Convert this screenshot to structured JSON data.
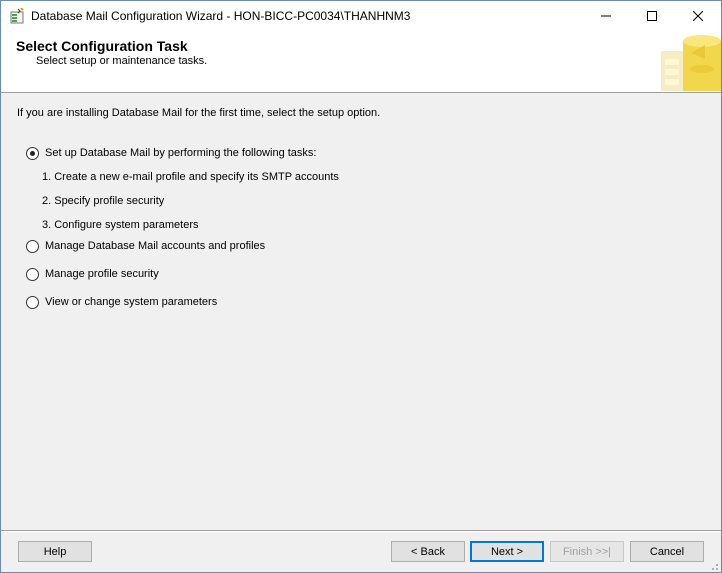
{
  "window": {
    "title": "Database Mail Configuration Wizard - HON-BICC-PC0034\\THANHNM3"
  },
  "header": {
    "title": "Select Configuration Task",
    "subtitle": "Select setup or maintenance tasks."
  },
  "main": {
    "intro": "If you are installing Database Mail for the first time, select the setup option.",
    "options": [
      {
        "label": "Set up Database Mail by performing the following tasks:",
        "selected": true
      },
      {
        "label": "Manage Database Mail accounts and profiles",
        "selected": false
      },
      {
        "label": "Manage profile security",
        "selected": false
      },
      {
        "label": "View or change system parameters",
        "selected": false
      }
    ],
    "setup_steps": [
      "1. Create a new e-mail profile and specify its SMTP accounts",
      "2. Specify profile security",
      "3. Configure system parameters"
    ]
  },
  "footer": {
    "help": "Help",
    "back": "< Back",
    "next": "Next >",
    "finish": "Finish >>|",
    "cancel": "Cancel"
  },
  "icons": {
    "app": "wizard-database-icon",
    "minimize": "minimize-icon",
    "maximize": "maximize-icon",
    "close": "close-icon",
    "banner": "database-cylinder-art"
  },
  "colors": {
    "accent": "#0078d7",
    "banner_art": "#f2d64b"
  }
}
